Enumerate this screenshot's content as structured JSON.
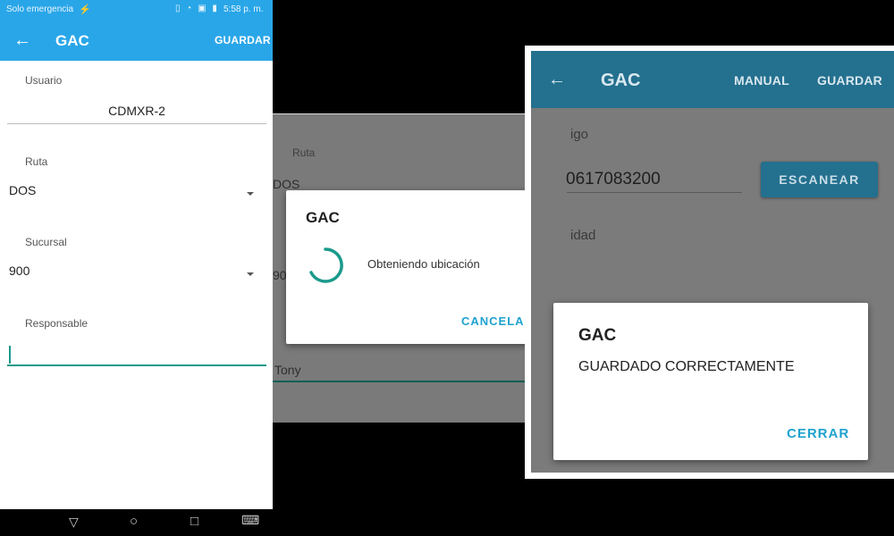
{
  "screen1": {
    "status": {
      "left": "Solo emergencia",
      "right": "5:58 p. m."
    },
    "appbar": {
      "title": "GAC",
      "action": "GUARDAR"
    },
    "form": {
      "usuario_label": "Usuario",
      "usuario_value": "CDMXR-2",
      "ruta_label": "Ruta",
      "ruta_value": "DOS",
      "sucursal_label": "Sucursal",
      "sucursal_value": "900",
      "responsable_label": "Responsable",
      "responsable_value": ""
    }
  },
  "screen2": {
    "background": {
      "ruta_label": "Ruta",
      "ruta_value": "DOS",
      "sucursal_value_partial": "90",
      "responsable_value": "Tony"
    },
    "dialog": {
      "title": "GAC",
      "message": "Obteniendo ubicación",
      "button": "CANCELAR"
    }
  },
  "screen3": {
    "appbar": {
      "title": "GAC",
      "action_manual": "MANUAL",
      "action_save": "GUARDAR"
    },
    "background": {
      "codigo_label_partial": "igo",
      "codigo_value": "0617083200",
      "scan_button": "ESCANEAR",
      "cantidad_label_partial": "idad"
    },
    "dialog": {
      "title": "GAC",
      "message": "GUARDADO CORRECTAMENTE",
      "button": "CERRAR"
    }
  },
  "colors": {
    "appbar_blue": "#29a6e8",
    "dim_appbar_blue": "#24708f",
    "accent_teal": "#1fa2cf",
    "spinner_teal": "#1a9a8c"
  }
}
